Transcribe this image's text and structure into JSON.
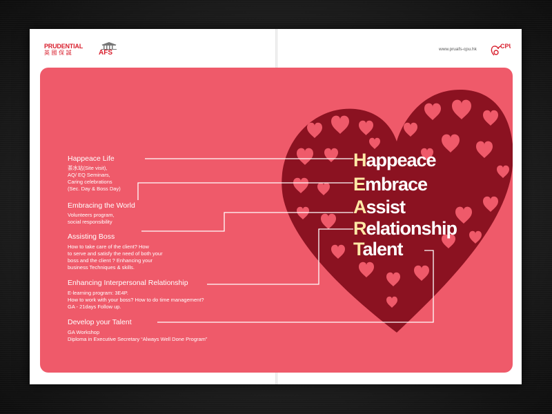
{
  "header": {
    "prudential_name": "PRUDENTIAL",
    "prudential_chinese": "英 國 保 誠",
    "afs_logo": "AFS",
    "website": "www.pruafs-cpu.hk",
    "cpu_logo": "CPU"
  },
  "heart_words": [
    {
      "initial": "H",
      "rest": "appeace"
    },
    {
      "initial": "E",
      "rest": "mbrace"
    },
    {
      "initial": "A",
      "rest": "ssist"
    },
    {
      "initial": "R",
      "rest": "elationship"
    },
    {
      "initial": "T",
      "rest": "alent"
    }
  ],
  "items": [
    {
      "title": "Happeace Life",
      "lines": [
        "茶水站(Site visit),",
        "AQ/ EQ Seminars,",
        "Caring celebrations",
        "(Sec. Day & Boss Day)"
      ]
    },
    {
      "title": "Embracing the World",
      "lines": [
        "Volunteers program,",
        "social responsibility"
      ]
    },
    {
      "title": "Assisting Boss",
      "lines": [
        "How to take care of the client? How",
        "to serve and satisfy the need of both your",
        "boss and the client ? Enhancing your",
        "business Techniques & skills."
      ]
    },
    {
      "title": "Enhancing Interpersonal Relationship",
      "lines": [
        "E-learning program: 3E4P.",
        "How to work with your boss? How to do time management?",
        "GA - 21days Follow up."
      ]
    },
    {
      "title": "Develop your Talent",
      "lines": [
        "GA Workshop",
        "Diploma in Executive Secretary “Always Well Done Program”"
      ]
    }
  ],
  "colors": {
    "panel": "#ef5a6a",
    "heart": "#8b1221",
    "heart_cutout": "#ef5a6a",
    "initial_letters": "#ffe9a6",
    "brand_red": "#d81e2c"
  }
}
